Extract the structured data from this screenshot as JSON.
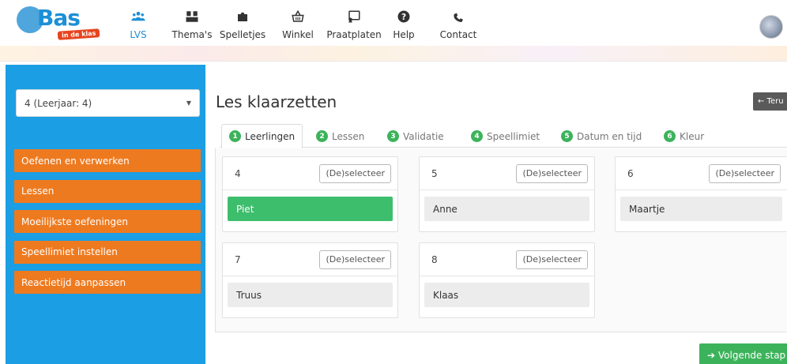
{
  "header": {
    "logo_text": "Bas",
    "logo_sub": "in de klas",
    "nav": [
      {
        "label": "LVS",
        "icon": "users-icon",
        "active": true
      },
      {
        "label": "Thema's",
        "icon": "themes-icon"
      },
      {
        "label": "Spelletjes",
        "icon": "puzzle-icon"
      },
      {
        "label": "Winkel",
        "icon": "shop-icon"
      },
      {
        "label": "Praatplaten",
        "icon": "picture-icon"
      },
      {
        "label": "Help",
        "icon": "question-icon"
      },
      {
        "label": "Contact",
        "icon": "phone-icon"
      }
    ],
    "accent_color": "#1f8fd6"
  },
  "sidebar": {
    "select_value": "4 (Leerjaar: 4)",
    "menu": [
      "Oefenen en verwerken",
      "Lessen",
      "Moeilijkste oefeningen",
      "Speellimiet instellen",
      "Reactietijd aanpassen"
    ],
    "bg_color": "#1b9ee3",
    "menu_color": "#ee7a1f"
  },
  "main": {
    "title": "Les klaarzetten",
    "back_label": "← Teru",
    "tabs": [
      {
        "num": "1",
        "label": "Leerlingen",
        "active": true
      },
      {
        "num": "2",
        "label": "Lessen"
      },
      {
        "num": "3",
        "label": "Validatie"
      },
      {
        "num": "4",
        "label": "Speellimiet"
      },
      {
        "num": "5",
        "label": "Datum en tijd"
      },
      {
        "num": "6",
        "label": "Kleur"
      }
    ],
    "cards": [
      {
        "group": "4",
        "toggle": "(De)selecteer",
        "student": "Piet",
        "selected": true
      },
      {
        "group": "5",
        "toggle": "(De)selecteer",
        "student": "Anne"
      },
      {
        "group": "6",
        "toggle": "(De)selecteer",
        "student": "Maartje"
      },
      {
        "group": "7",
        "toggle": "(De)selecteer",
        "student": "Truus"
      },
      {
        "group": "8",
        "toggle": "(De)selecteer",
        "student": "Klaas"
      }
    ],
    "next_label": "➔ Volgende stap",
    "green_color": "#3cb35b"
  }
}
